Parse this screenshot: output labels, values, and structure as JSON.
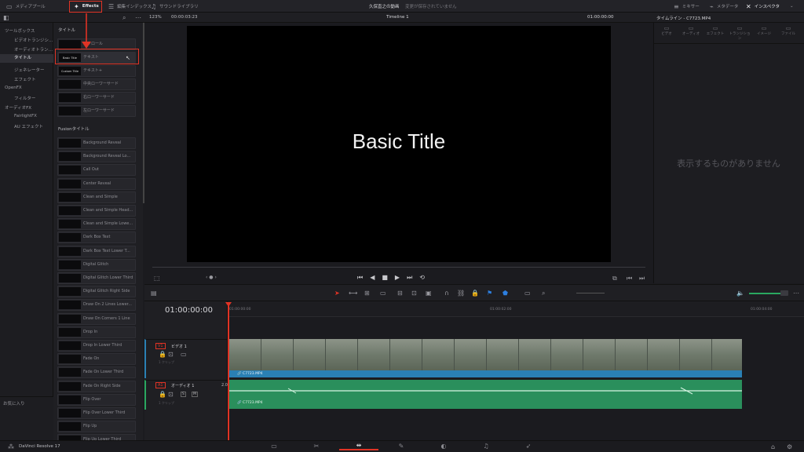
{
  "topbar": {
    "media_pool": "メディアプール",
    "effects": "Effects",
    "edit_index": "編集インデックス",
    "sound_library": "サウンドライブラリ",
    "project_title": "久保直之の動画",
    "saved_status": "変更が保存されていません",
    "mixer": "ミキサー",
    "metadata": "メタデータ",
    "inspector": "インスペクタ"
  },
  "bar2": {
    "zoom": "123%",
    "timecode_left": "00:00:03:23",
    "timeline_name": "Timeline 1",
    "timecode_right": "01:00:00:00",
    "inspector_title": "タイムライン - C7723.MP4"
  },
  "tree": {
    "toolbox": "ツールボックス",
    "video_transitions": "ビデオトランジシ…",
    "audio_transitions": "オーディオトラン…",
    "titles": "タイトル",
    "generators": "ジェネレーター",
    "effects": "エフェクト",
    "openfx": "OpenFX",
    "filters": "フィルター",
    "audiofx": "オーディオFX",
    "fairlightfx": "FairlightFX",
    "aufx": "AU エフェクト",
    "favorites": "お気に入り"
  },
  "fxlist": {
    "titles_header": "タイトル",
    "fusion_header": "Fusionタイトル",
    "titles": [
      {
        "thumb": "",
        "label": "スクロール"
      },
      {
        "thumb": "Basic Title",
        "label": "テキスト"
      },
      {
        "thumb": "Custom Title",
        "label": "テキスト+"
      },
      {
        "thumb": "",
        "label": "中央ローワーサード"
      },
      {
        "thumb": "",
        "label": "右ローワーサード"
      },
      {
        "thumb": "",
        "label": "左ローワーサード"
      }
    ],
    "fusion": [
      "Background Reveal",
      "Background Reveal Lo...",
      "Call Out",
      "Center Reveal",
      "Clean and Simple",
      "Clean and Simple Head...",
      "Clean and Simple Lowe...",
      "Dark Box Text",
      "Dark Box Text Lower T...",
      "Digital Glitch",
      "Digital Glitch Lower Third",
      "Digital Glitch Right Side",
      "Draw On 2 Lines Lower...",
      "Draw On Corners 1 Line",
      "Drop In",
      "Drop In Lower Third",
      "Fade On",
      "Fade On Lower Third",
      "Fade On Right Side",
      "Flip Over",
      "Flip Over Lower Third",
      "Flip Up",
      "Flip Up Lower Third"
    ]
  },
  "viewer": {
    "title_text": "Basic Title"
  },
  "inspector": {
    "tabs": [
      "ビデオ",
      "オーディオ",
      "エフェクト",
      "トランジション",
      "イメージ",
      "ファイル"
    ],
    "empty_message": "表示するものがありません"
  },
  "timeline": {
    "timecode": "01:00:00:00",
    "ruler": [
      "01:00:00:00",
      "01:00:02:00",
      "01:00:04:00"
    ],
    "v1_tag": "V1",
    "v1_name": "ビデオ 1",
    "v1_clips": "1 クリップ",
    "a1_tag": "A1",
    "a1_name": "オーディオ 1",
    "a1_level": "2.0",
    "a1_clips": "1 クリップ",
    "video_clip": "C7723.MP4",
    "audio_clip": "C7723.MP4"
  },
  "footer": {
    "app_name": "DaVinci Resolve 17"
  }
}
